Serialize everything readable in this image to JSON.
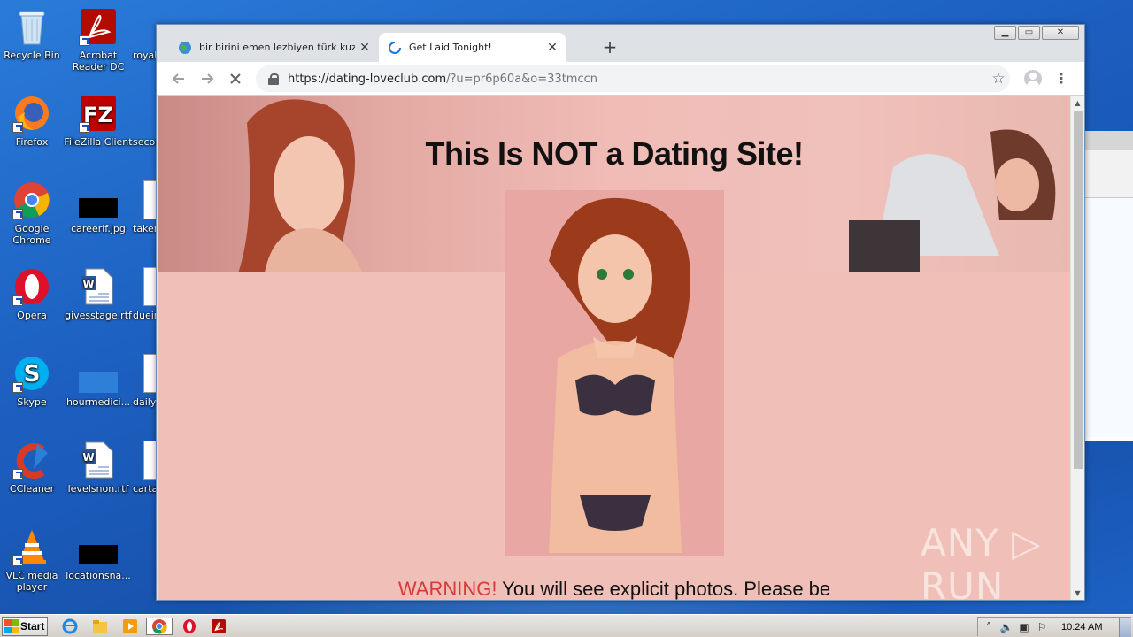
{
  "desktop": {
    "icons": [
      {
        "label": "Recycle Bin",
        "icon": "recycle-bin-icon"
      },
      {
        "label": "Acrobat Reader DC",
        "icon": "acrobat-icon"
      },
      {
        "label": "royal",
        "icon": "word-doc-icon"
      },
      {
        "label": "Firefox",
        "icon": "firefox-icon"
      },
      {
        "label": "FileZilla Client",
        "icon": "filezilla-icon"
      },
      {
        "label": "secor",
        "icon": "word-doc-icon"
      },
      {
        "label": "Google Chrome",
        "icon": "chrome-icon"
      },
      {
        "label": "careerif.jpg",
        "icon": "image-file-icon"
      },
      {
        "label": "taken",
        "icon": "word-doc-icon"
      },
      {
        "label": "Opera",
        "icon": "opera-icon"
      },
      {
        "label": "givesstage.rtf",
        "icon": "word-doc-icon"
      },
      {
        "label": "duein",
        "icon": "word-doc-icon"
      },
      {
        "label": "Skype",
        "icon": "skype-icon"
      },
      {
        "label": "hourmedici...",
        "icon": "blue-file-icon"
      },
      {
        "label": "daily",
        "icon": "word-doc-icon"
      },
      {
        "label": "CCleaner",
        "icon": "ccleaner-icon"
      },
      {
        "label": "levelsnon.rtf",
        "icon": "word-doc-icon"
      },
      {
        "label": "carta",
        "icon": "word-doc-icon"
      },
      {
        "label": "VLC media player",
        "icon": "vlc-icon"
      },
      {
        "label": "locationsna...",
        "icon": "image-file-icon"
      }
    ]
  },
  "browser": {
    "tabs": [
      {
        "title": "bir birini emen lezbiyen türk kuzenler",
        "icon": "globe-favicon-icon",
        "active": false
      },
      {
        "title": "Get Laid Tonight!",
        "icon": "loading-spinner-icon",
        "active": true
      }
    ],
    "new_tab_label": "+",
    "close_glyph": "✕",
    "url": {
      "host": "https://dating-loveclub.com",
      "path": "/?u=pr6p60a&o=33tmccn"
    },
    "window_controls": {
      "minimize": "▁",
      "maximize": "▭",
      "close": "✕"
    }
  },
  "page": {
    "headline": "This Is NOT a Dating Site!",
    "warning_prefix": "WARNING!",
    "warning_text": "You will see explicit photos. Please be"
  },
  "watermark": {
    "text": "ANY ▷ RUN"
  },
  "taskbar": {
    "start_label": "Start",
    "clock": "10:24 AM"
  },
  "colors": {
    "accent_warning": "#d73a3a",
    "page_bg": "#f0c0b8",
    "desktop_blue": "#1c5fc0"
  }
}
